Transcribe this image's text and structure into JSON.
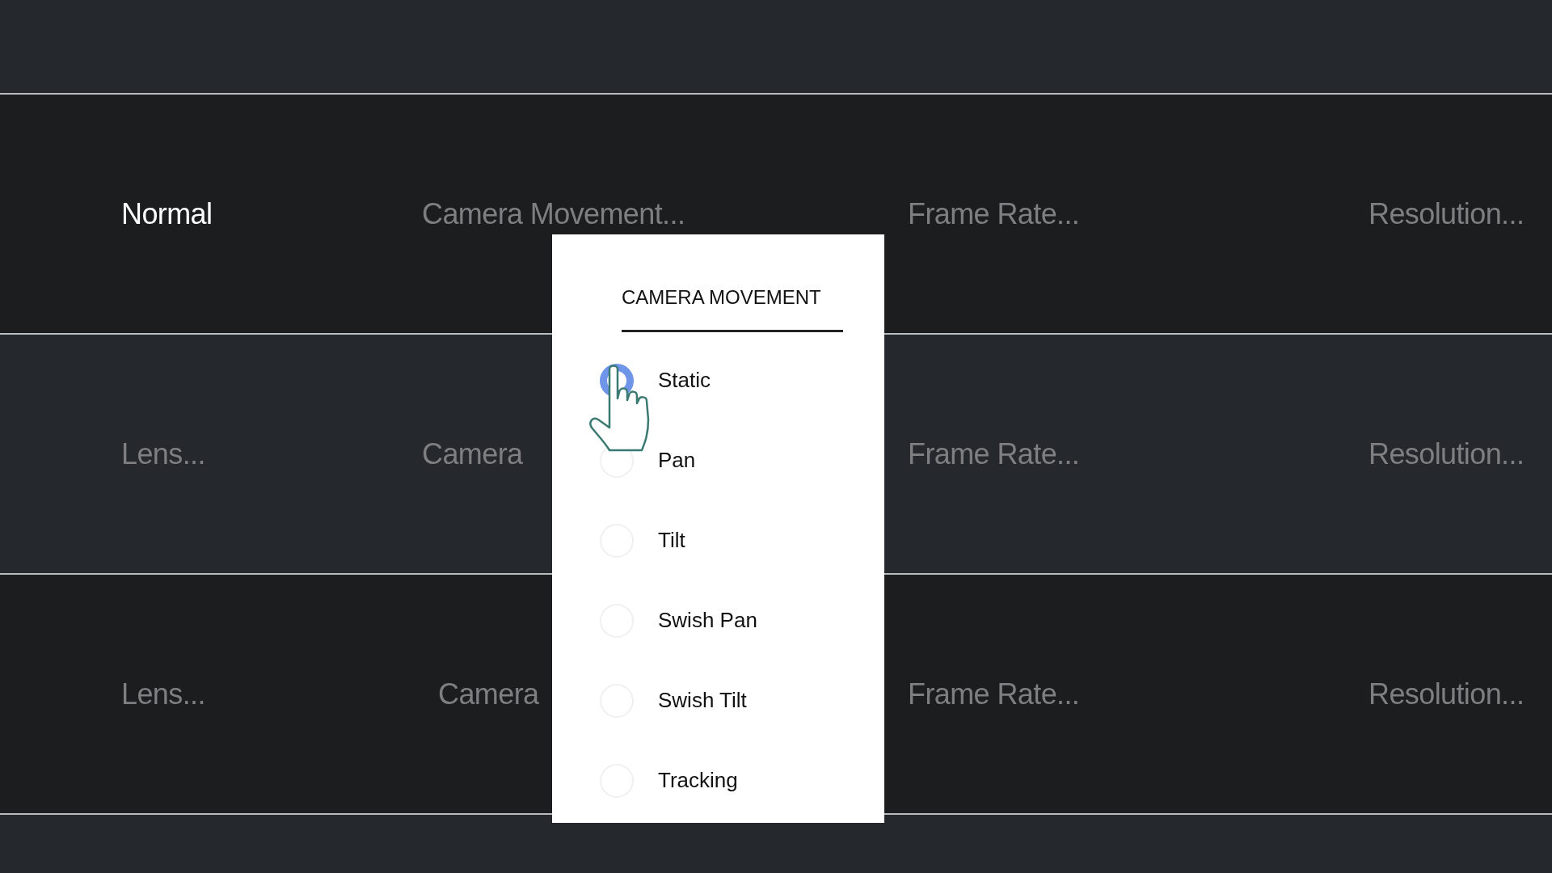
{
  "rows": [
    {
      "cells": [
        {
          "text": "Normal",
          "bright": true
        },
        {
          "text": "Camera Movement...",
          "bright": false
        },
        {
          "text": "Frame Rate...",
          "bright": false
        },
        {
          "text": "Resolution...",
          "bright": false
        }
      ]
    },
    {
      "cells": [
        {
          "text": "Lens...",
          "bright": false
        },
        {
          "text": "Camera",
          "bright": false
        },
        {
          "text": "Frame Rate...",
          "bright": false
        },
        {
          "text": "Resolution...",
          "bright": false
        }
      ]
    },
    {
      "cells": [
        {
          "text": "Lens...",
          "bright": false
        },
        {
          "text": "Camera",
          "bright": false
        },
        {
          "text": "Frame Rate...",
          "bright": false
        },
        {
          "text": "Resolution...",
          "bright": false
        }
      ]
    }
  ],
  "popup": {
    "title": "CAMERA MOVEMENT",
    "options": [
      {
        "label": "Static",
        "selected": true
      },
      {
        "label": "Pan",
        "selected": false
      },
      {
        "label": "Tilt",
        "selected": false
      },
      {
        "label": "Swish Pan",
        "selected": false
      },
      {
        "label": "Swish Tilt",
        "selected": false
      },
      {
        "label": "Tracking",
        "selected": false
      }
    ]
  }
}
